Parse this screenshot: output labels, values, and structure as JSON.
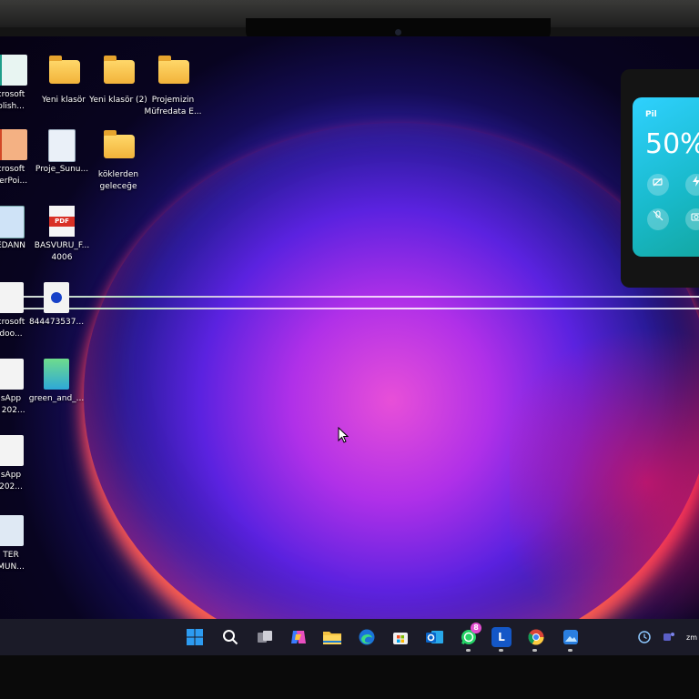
{
  "desktop": {
    "icons": [
      {
        "label": "crosoft\nblish..."
      },
      {
        "label": "Yeni klasör"
      },
      {
        "label": "Yeni klasör (2)"
      },
      {
        "label": "Projemizin\nMüfredata E..."
      },
      {
        "label": "crosoft\nverPoi..."
      },
      {
        "label": "Proje_Sunu..."
      },
      {
        "label": "köklerden\ngeleceğe"
      },
      {
        "label": "EDANN"
      },
      {
        "label": "BASVURU_F...\n4006"
      },
      {
        "label": "crosoft\ndoo..."
      },
      {
        "label": "844473537..."
      },
      {
        "label": "sApp\nl 202..."
      },
      {
        "label": "green_and_..."
      },
      {
        "label": "sApp\n202..."
      },
      {
        "label": "TER\nMUN..."
      }
    ],
    "pdf_badge": "PDF"
  },
  "quick_settings": {
    "title": "Pil",
    "battery_percent": "50%",
    "buttons": [
      "battery-saver-icon",
      "power-mode-icon",
      "mic-off-icon",
      "camera-icon"
    ]
  },
  "taskbar": {
    "apps": [
      "windows-start-icon",
      "search-icon",
      "task-view-icon",
      "copilot-icon",
      "file-explorer-icon",
      "edge-icon",
      "microsoft-store-icon",
      "outlook-icon",
      "whatsapp-icon",
      "l-app-icon",
      "chrome-icon",
      "photos-icon"
    ],
    "whatsapp_badge": "8",
    "l_app_label": "L",
    "tray_zm": "zm"
  },
  "colors": {
    "folder": "#f2b33a",
    "windows_blue": "#2d9bf0",
    "whatsapp_green": "#25d366",
    "quick_settings_accent": "#2fd1ff"
  }
}
